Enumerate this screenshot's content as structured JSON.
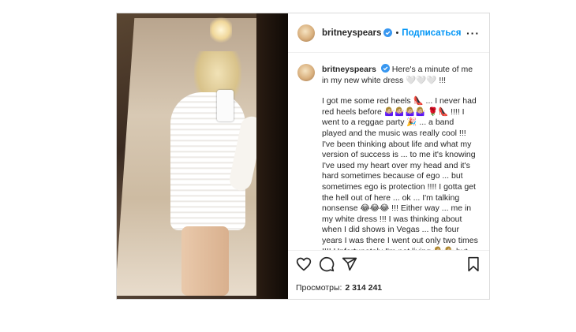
{
  "post": {
    "username": "britneyspears",
    "dot": "•",
    "follow_label": "Подписаться",
    "more_label": "···",
    "caption_title": "Here's a minute of me in my new white dress 🤍🤍🤍 !!!",
    "caption_body": "I got me some red heels 👠 ... I never had red heels before 🤷🏼‍♀️🤷🏼‍♀️🤷🏼‍♀️🤷🏼‍♀️ 🌹👠 !!!! I went to a reggae party 🎉 ... a band played and the music was really cool !!! I've been thinking about life and what my version of success is ... to me it's knowing I've used my heart over my head and it's hard sometimes because of ego ... but sometimes ego is protection !!!! I gotta get the hell out of here ... ok ... I'm talking nonsense 😂😂😂 !!! Either way ... me in my white dress !!! I was thinking about when I did shows in Vegas ... the four years I was there I went out only two times !!!! Unfortunately I'm not living 🤷🏼‍♀️🤷🏼‍♀️ but that's not why I'm",
    "views_label": "Просмотры:",
    "views_count": "2 314 241"
  },
  "icons": {
    "verified": "verified-badge-icon",
    "like": "heart-icon",
    "comment": "comment-icon",
    "share": "share-icon",
    "save": "bookmark-icon"
  },
  "colors": {
    "follow_blue": "#0095f6",
    "text": "#262626",
    "border": "#dbdbdb"
  }
}
